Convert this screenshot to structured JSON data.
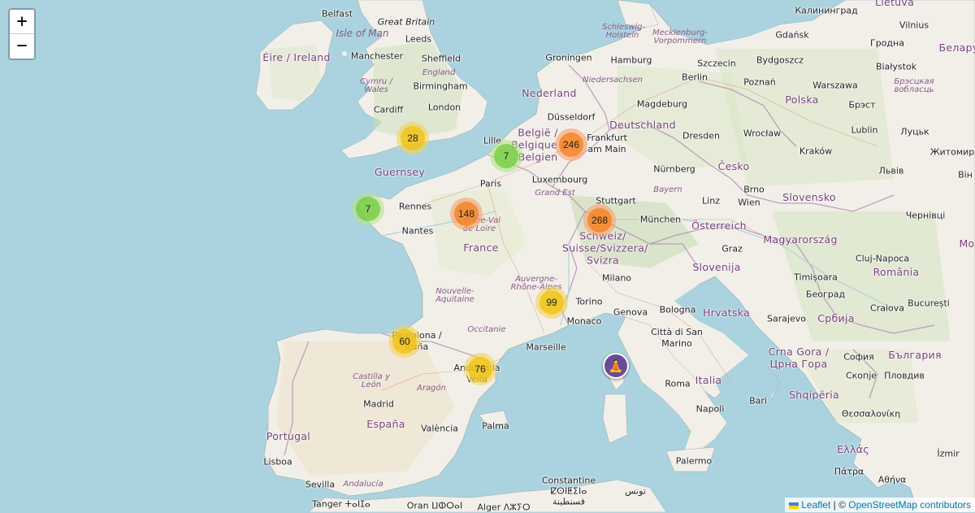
{
  "zoom": {
    "in_label": "+",
    "out_label": "−"
  },
  "attribution": {
    "leaflet": "Leaflet",
    "separator": " | © ",
    "osm": "OpenStreetMap contributors"
  },
  "clusters": [
    {
      "count": "28",
      "size": "medium"
    },
    {
      "count": "7",
      "size": "small"
    },
    {
      "count": "246",
      "size": "large"
    },
    {
      "count": "7",
      "size": "small"
    },
    {
      "count": "148",
      "size": "large"
    },
    {
      "count": "268",
      "size": "large"
    },
    {
      "count": "99",
      "size": "medium"
    },
    {
      "count": "60",
      "size": "medium"
    },
    {
      "count": "76",
      "size": "medium"
    }
  ],
  "poi": {
    "icon": "meditation-icon",
    "symbol": "🧘"
  },
  "labels": {
    "belfast": "Belfast",
    "great_britain": "Great Britain",
    "isle_of_man": "Isle of Man",
    "leeds": "Leeds",
    "eire": "Éire / Ireland",
    "manchester": "Manchester",
    "sheffield": "Sheffield",
    "england": "England",
    "cymru": "Cymru / Wales",
    "birmingham": "Birmingham",
    "cardiff": "Cardiff",
    "london": "London",
    "guernsey": "Guernsey",
    "rennes": "Rennes",
    "nantes": "Nantes",
    "centre": "Centre-Val de Loire",
    "france": "France",
    "paris": "Paris",
    "lille": "Lille",
    "belgie": "België / Belgique / Belgien",
    "nederland": "Nederland",
    "groningen": "Groningen",
    "dusseldorf": "Düsseldorf",
    "frankfurt": "Frankfurt am Main",
    "luxembourg": "Luxembourg",
    "grand_est": "Grand Est",
    "stuttgart": "Stuttgart",
    "munchen": "München",
    "schweiz": "Schweiz/ Suisse/Svizzera/ Svizra",
    "milano": "Milano",
    "torino": "Torino",
    "genova": "Genova",
    "monaco": "Monaco",
    "marseille": "Marseille",
    "occitanie": "Occitanie",
    "nouvelle": "Nouvelle- Aquitaine",
    "auvergne": "Auvergne- Rhône-Alpes",
    "pamplona": "Pamplona / Iruña",
    "andorra": "Andorra la Vella",
    "castilla": "Castilla y León",
    "aragon": "Aragón",
    "madrid": "Madrid",
    "espana": "España",
    "valencia": "València",
    "palma": "Palma",
    "portugal": "Portugal",
    "lisboa": "Lisboa",
    "sevilla": "Sevilla",
    "andalucia": "Andalucía",
    "tanger": "Tanger ⵜⴰⵏⵊⴰ",
    "oran": "Oran ⵡⵀⵔⴰⵏ",
    "alger": "Alger ⴷⵣⵢⵔ",
    "constantine": "Constantine ⵇⵙⵏⵟⵉⵏⴰ قسنطينة",
    "tunis": "تونس",
    "schleswig": "Schleswig- Holstein",
    "mecklenburg": "Mecklenburg- Vorpommern",
    "hamburg": "Hamburg",
    "niedersachsen": "Niedersachsen",
    "berlin": "Berlin",
    "magdeburg": "Magdeburg",
    "deutschland": "Deutschland",
    "dresden": "Dresden",
    "nurnberg": "Nürnberg",
    "bayern": "Bayern",
    "cesko": "Česko",
    "linz": "Linz",
    "wien": "Wien",
    "brno": "Brno",
    "osterreich": "Österreich",
    "slovensko": "Slovensko",
    "graz": "Graz",
    "magyarorszag": "Magyarország",
    "slovenija": "Slovenija",
    "hrvatska": "Hrvatska",
    "bologna": "Bologna",
    "citta_san_marino": "Città di San Marino",
    "italia": "Italia",
    "roma": "Roma",
    "napoli": "Napoli",
    "bari": "Bari",
    "palermo": "Palermo",
    "szczecin": "Szczecin",
    "bydgoszcz": "Bydgoszcz",
    "gdansk": "Gdańsk",
    "kaliningrad": "Калининград",
    "lietuva": "Lietuva",
    "vilnius": "Vilnius",
    "hrodna": "Гродна",
    "poznan": "Poznań",
    "warszawa": "Warszawa",
    "bialystok": "Białystok",
    "polska": "Polska",
    "brest": "Брэст",
    "wroclaw": "Wrocław",
    "lublin": "Lublin",
    "lutsk": "Луцьк",
    "krakow": "Kraków",
    "lviv": "Львів",
    "zhytomyr": "Житомир",
    "vinn": "Він",
    "chernivtsi": "Чернівці",
    "berastsei": "Брэсцкая вобласць",
    "bielarus": "Белару",
    "cluj": "Cluj-Napoca",
    "romania": "România",
    "timisoara": "Timișoara",
    "beograd": "Београд",
    "craiova": "Craiova",
    "bucuresti": "București",
    "srbija": "Србија",
    "sarajevo": "Sarajevo",
    "crna_gora": "Crna Gora / Црна Гора",
    "sofiya": "София",
    "balgariya": "България",
    "skopje": "Скопје",
    "plovdiv": "Пловдив",
    "shqiperia": "Shqipëria",
    "thessaloniki": "Θεσσαλονίκη",
    "ellas": "Ελλάς",
    "patra": "Πάτρα",
    "athina": "Αθήνα",
    "izmir": "İzmir",
    "mo": "Mo"
  }
}
